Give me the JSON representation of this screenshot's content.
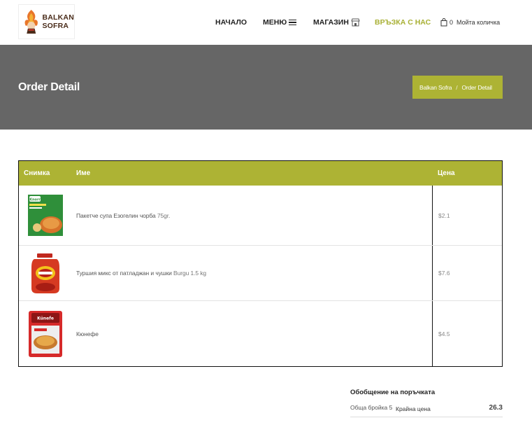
{
  "header": {
    "logo_line1": "BALKAN",
    "logo_line2": "SOFRA",
    "nav": {
      "home": "НАЧАЛО",
      "menu": "МЕНЮ",
      "shop": "МАГАЗИН",
      "contact": "ВРЪЗКА С НАС",
      "cart_count": "0",
      "cart_label": "Мойта количка"
    },
    "colors": {
      "accent": "#adb334",
      "contact_active": "#a8b034"
    }
  },
  "banner": {
    "title": "Order Detail",
    "breadcrumb": {
      "home": "Balkan Sofra",
      "separator": "/",
      "current": "Order Detail"
    }
  },
  "table": {
    "headers": {
      "image": "Снимка",
      "name": "Име",
      "price": "Цена"
    },
    "rows": [
      {
        "name": "Пакетче супа Езогелин чорба",
        "detail": "75gr.",
        "price": "$2.1",
        "image_icon": "knorr-soup-packet-icon"
      },
      {
        "name": "Туршия микс от патладжан и чушки",
        "detail": "Burgu 1.5 kg",
        "price": "$7.6",
        "image_icon": "pickle-jar-icon"
      },
      {
        "name": "Кюнефе",
        "detail": "",
        "price": "$4.5",
        "image_icon": "kunefe-package-icon"
      }
    ]
  },
  "summary": {
    "title": "Обобщение на поръчката",
    "count_label": "Обща бройка 5",
    "final_label": "Крайна цена",
    "total": "26.3"
  }
}
